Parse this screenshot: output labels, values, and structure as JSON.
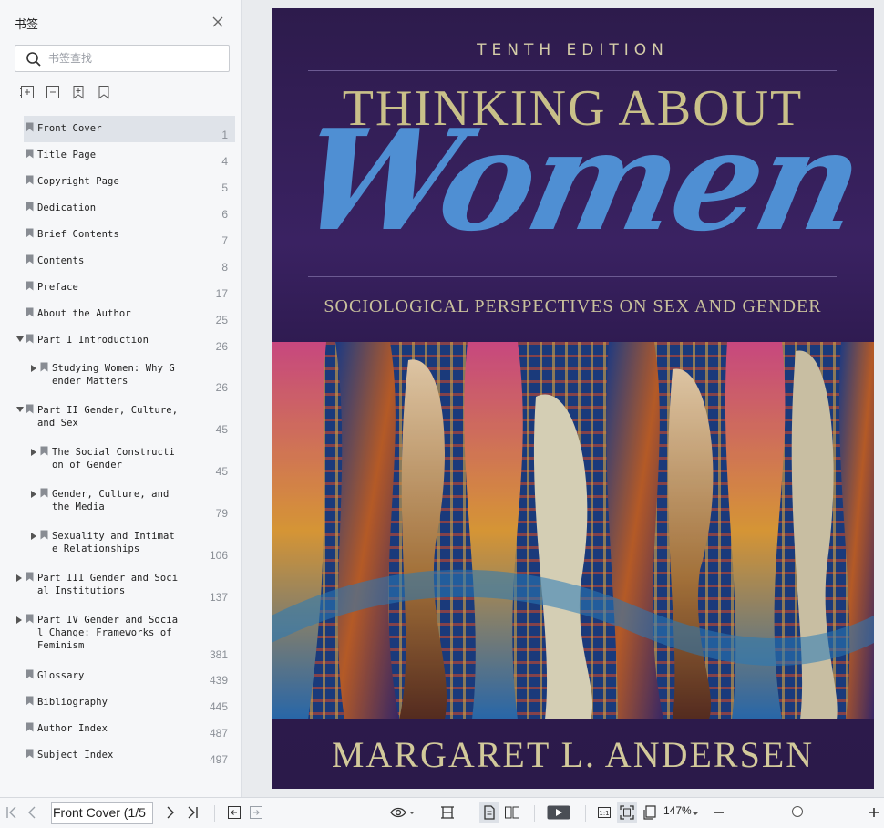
{
  "sidebar": {
    "title": "书签",
    "search_placeholder": "书签查找",
    "bookmarks": [
      {
        "label": "Front Cover",
        "page": "1"
      },
      {
        "label": "Title Page",
        "page": "4"
      },
      {
        "label": "Copyright Page",
        "page": "5"
      },
      {
        "label": "Dedication",
        "page": "6"
      },
      {
        "label": "Brief Contents",
        "page": "7"
      },
      {
        "label": "Contents",
        "page": "8"
      },
      {
        "label": "Preface",
        "page": "17"
      },
      {
        "label": "About the Author",
        "page": "25"
      },
      {
        "label": "Part I Introduction",
        "page": "26"
      },
      {
        "label": "Studying Women: Why G\nender Matters",
        "page": "26"
      },
      {
        "label": "Part II Gender, Culture,\nand Sex",
        "page": "45"
      },
      {
        "label": "The Social Constructi\non of Gender",
        "page": "45"
      },
      {
        "label": "Gender, Culture, and\nthe Media",
        "page": "79"
      },
      {
        "label": "Sexuality and Intimat\ne Relationships",
        "page": "106"
      },
      {
        "label": "Part III Gender and Soci\nal Institutions",
        "page": "137"
      },
      {
        "label": "Part IV Gender and Socia\nl Change: Frameworks of\nFeminism",
        "page": "381"
      },
      {
        "label": "Glossary",
        "page": "439"
      },
      {
        "label": "Bibliography",
        "page": "445"
      },
      {
        "label": "Author Index",
        "page": "487"
      },
      {
        "label": "Subject Index",
        "page": "497"
      }
    ]
  },
  "cover": {
    "edition": "TENTH EDITION",
    "title_top": "THINKING ABOUT",
    "title_script": "Women",
    "subtitle": "SOCIOLOGICAL PERSPECTIVES ON SEX AND GENDER",
    "author": "MARGARET L. ANDERSEN"
  },
  "toolbar": {
    "page_field": "Front Cover (1/5",
    "zoom": "147%"
  },
  "colors": {
    "cover_bg": "#2d1b4c",
    "script_blue": "#4f8fd3",
    "title_gold": "#c9c089",
    "selection": "#dfe3e9"
  }
}
